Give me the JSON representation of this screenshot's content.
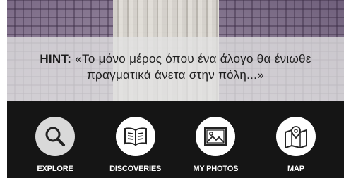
{
  "hint": {
    "label": "HINT:",
    "text": "«Το μόνο μέρος όπου ένα άλογο θα ένιωθε πραγματικά άνετα στην πόλη...»"
  },
  "nav": {
    "items": [
      {
        "label": "EXPLORE",
        "icon": "magnifier-icon",
        "active": true
      },
      {
        "label": "DISCOVERIES",
        "icon": "open-book-icon",
        "active": false
      },
      {
        "label": "MY PHOTOS",
        "icon": "photo-icon",
        "active": false
      },
      {
        "label": "MAP",
        "icon": "map-pin-icon",
        "active": false
      }
    ]
  },
  "colors": {
    "nav_background": "#151515",
    "nav_label": "#ffffff",
    "active_circle": "#d9d9d9",
    "circle": "#ffffff",
    "icon_stroke": "#222222"
  }
}
